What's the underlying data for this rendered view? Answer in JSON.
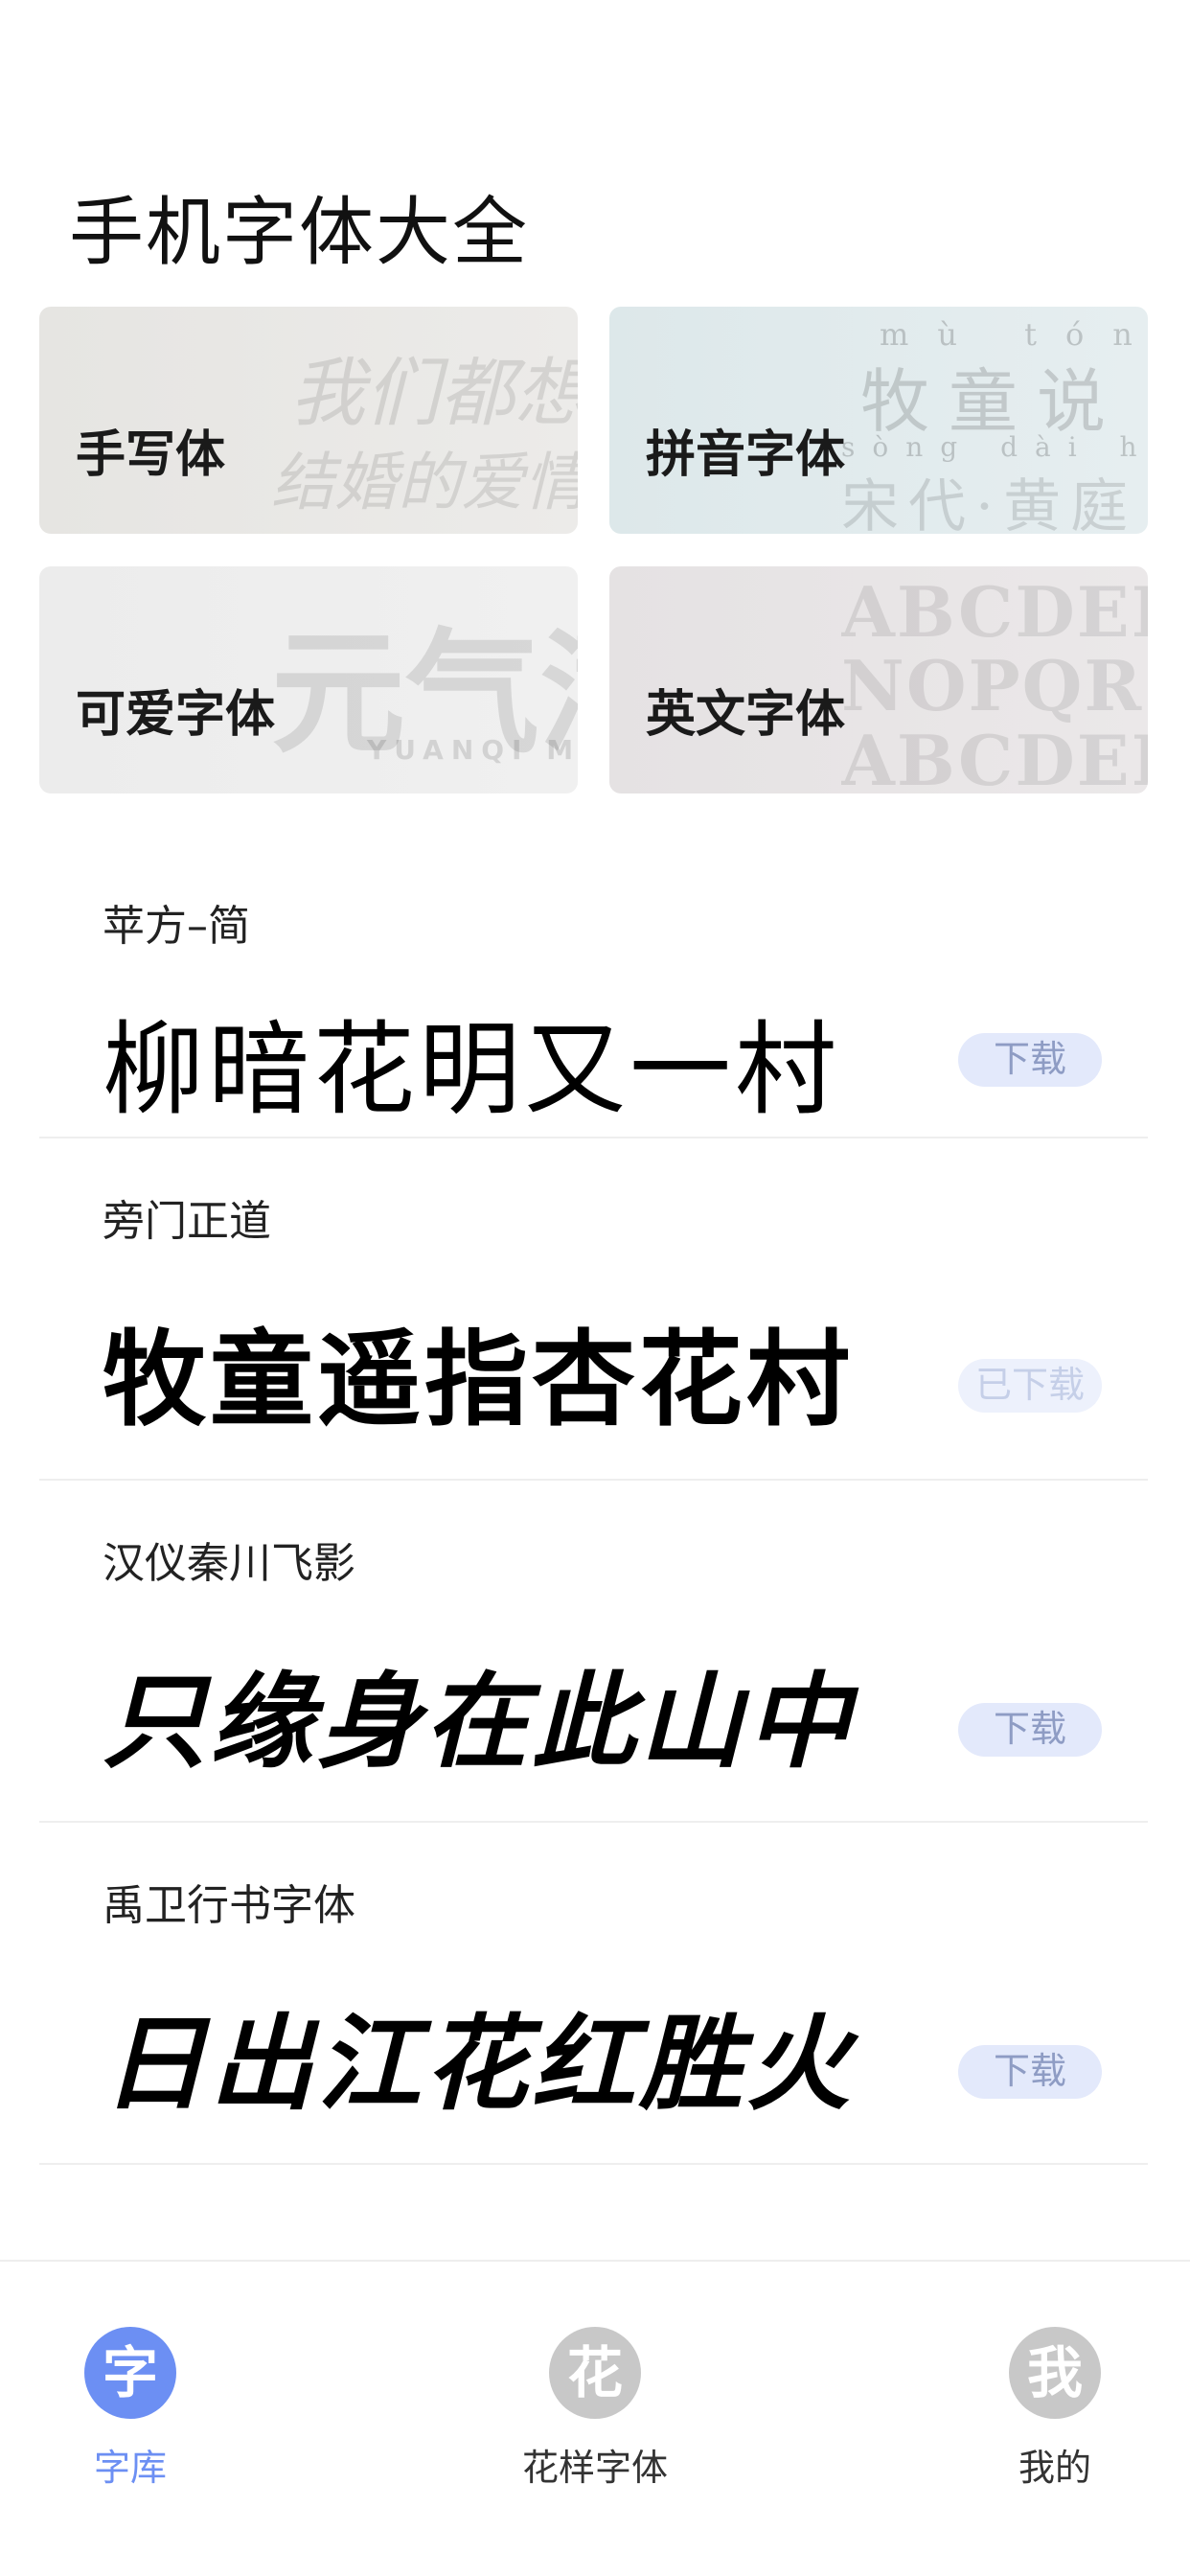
{
  "page": {
    "title": "手机字体大全"
  },
  "categories": [
    {
      "label": "手写体",
      "deco_line1": "我们都想要",
      "deco_line2": "结婚的爱情"
    },
    {
      "label": "拼音字体",
      "deco_pinyin1": "mù tóng sh",
      "deco_hanzi1": "牧童说",
      "deco_pinyin2": "sòng dài huáng tíng",
      "deco_hanzi2": "宋代·黄庭"
    },
    {
      "label": "可爱字体",
      "deco_big": "元气满",
      "deco_small": "YUANQI MAN"
    },
    {
      "label": "英文字体",
      "deco_row1": "ABCDEFG",
      "deco_row2": "NOPQRST",
      "deco_row3": "ABCDEFG"
    }
  ],
  "fonts": [
    {
      "name": "苹方–简",
      "sample": "柳暗花明又一村",
      "button": "下载",
      "status": "download"
    },
    {
      "name": "旁门正道",
      "sample": "牧童遥指杏花村",
      "button": "已下载",
      "status": "downloaded"
    },
    {
      "name": "汉仪秦川飞影",
      "sample": "只缘身在此山中",
      "button": "下载",
      "status": "download"
    },
    {
      "name": "禹卫行书字体",
      "sample": "日出江花红胜火",
      "button": "下载",
      "status": "download"
    }
  ],
  "tabbar": {
    "tabs": [
      {
        "icon": "字",
        "label": "字库",
        "active": true
      },
      {
        "icon": "花",
        "label": "花样字体",
        "active": false
      },
      {
        "icon": "我",
        "label": "我的",
        "active": false
      }
    ]
  },
  "colors": {
    "accent": "#6c8ff3",
    "button_bg": "#e3e9fb",
    "button_text": "#8e9cc4",
    "inactive_icon": "#c8c8c8"
  }
}
